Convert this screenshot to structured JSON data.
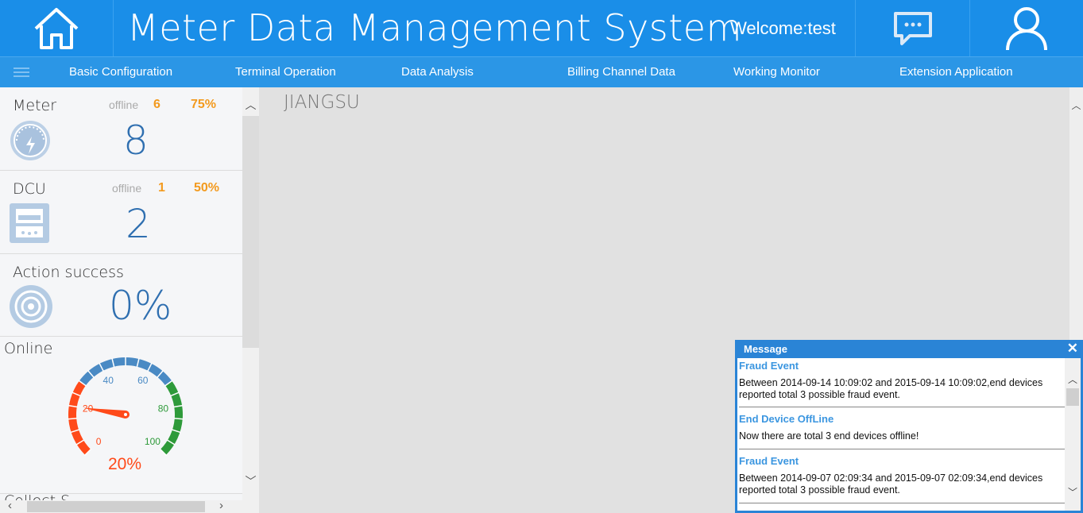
{
  "header": {
    "title": "Meter Data Management System",
    "welcome": "Welcome:test",
    "icons": {
      "home": "home-icon",
      "messages": "chat-bubble-icon",
      "user": "user-icon"
    }
  },
  "nav": {
    "items": [
      {
        "label": "Basic Configuration"
      },
      {
        "label": "Terminal Operation"
      },
      {
        "label": "Data Analysis"
      },
      {
        "label": "Billing Channel Data"
      },
      {
        "label": "Working Monitor"
      },
      {
        "label": "Extension Application"
      }
    ]
  },
  "sidebar": {
    "meter": {
      "label": "Meter",
      "offline_label": "offline",
      "offline_count": "6",
      "percent": "75%",
      "count": "8"
    },
    "dcu": {
      "label": "DCU",
      "offline_label": "offline",
      "offline_count": "1",
      "percent": "50%",
      "count": "2"
    },
    "action": {
      "label": "Action success",
      "value": "0%"
    },
    "online": {
      "label": "Online",
      "gauge_ticks": [
        "0",
        "20",
        "40",
        "60",
        "80",
        "100"
      ],
      "value_text": "20%",
      "value": 20
    },
    "next_card_partial": "Collect S"
  },
  "main": {
    "region": "JIANGSU"
  },
  "message": {
    "title": "Message",
    "items": [
      {
        "title": "Fraud Event",
        "body": "Between 2014-09-14 10:09:02 and 2015-09-14 10:09:02,end devices reported total 3 possible fraud event."
      },
      {
        "title": "End Device OffLine",
        "body": "Now there are total 3 end devices offline!"
      },
      {
        "title": "Fraud Event",
        "body": "Between 2014-09-07 02:09:34 and 2015-09-07 02:09:34,end devices reported total 3 possible fraud event."
      }
    ]
  },
  "colors": {
    "header": "#1a8ee8",
    "accent_orange": "#f39a1e",
    "count_blue": "#2f6fb0",
    "gauge_red": "#ff4a1a",
    "gauge_blue": "#4a8ac4",
    "gauge_green": "#2e9a3a"
  }
}
